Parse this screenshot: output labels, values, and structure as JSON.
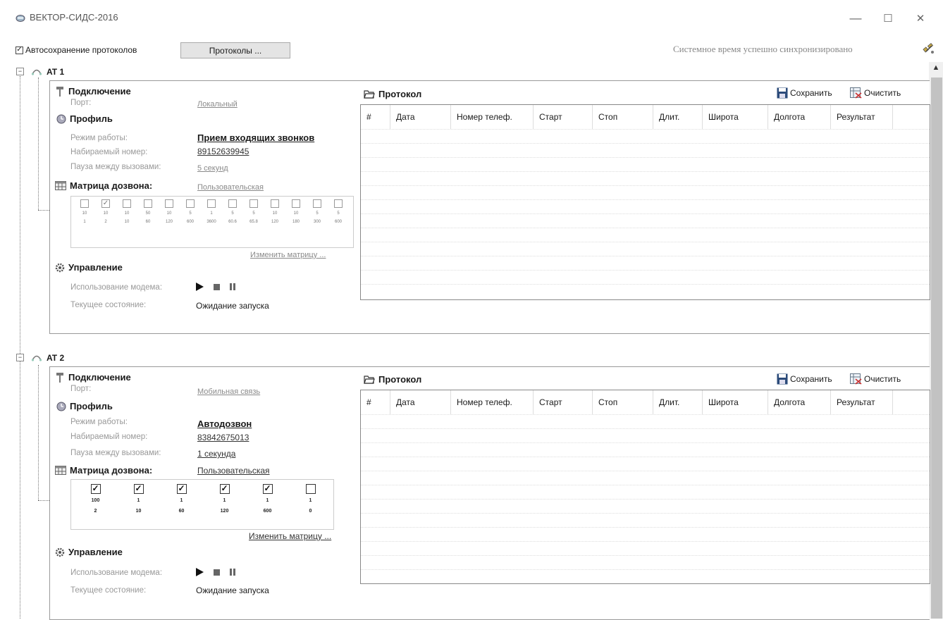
{
  "window": {
    "title": "ВЕКТОР-СИДС-2016",
    "minimize_glyph": "—",
    "maximize_glyph": "☐",
    "close_glyph": "✕"
  },
  "toolbar": {
    "autosave_label": "Автосохранение протоколов",
    "autosave_checked": true,
    "protocols_button": "Протоколы ...",
    "sync_status": "Системное время успешно синхронизировано"
  },
  "common": {
    "connection_title": "Подключение",
    "port_label": "Порт:",
    "profile_title": "Профиль",
    "mode_label": "Режим работы:",
    "dial_number_label": "Набираемый номер:",
    "pause_label": "Пауза между вызовами:",
    "matrix_title": "Матрица дозвона:",
    "change_matrix_link": "Изменить матрицу ...",
    "control_title": "Управление",
    "modem_usage_label": "Использование модема:",
    "current_state_label": "Текущее состояние:",
    "protocol_title": "Протокол",
    "save_button": "Сохранить",
    "clear_button": "Очистить",
    "columns": [
      "#",
      "Дата",
      "Номер телеф.",
      "Старт",
      "Стоп",
      "Длит.",
      "Широта",
      "Долгота",
      "Результат"
    ]
  },
  "nodes": [
    {
      "label": "AT 1",
      "port_value": "Локальный",
      "mode_value": "Прием входящих звонков",
      "dial_number": "89152639945",
      "pause_value": "5 секунд",
      "matrix_value": "Пользовательская",
      "state_value": "Ожидание запуска",
      "matrix_cells": [
        {
          "checked": false,
          "a": "10",
          "b": "1"
        },
        {
          "checked": true,
          "a": "10",
          "b": "2"
        },
        {
          "checked": false,
          "a": "10",
          "b": "10"
        },
        {
          "checked": false,
          "a": "50",
          "b": "60"
        },
        {
          "checked": false,
          "a": "10",
          "b": "120"
        },
        {
          "checked": false,
          "a": "5",
          "b": "600"
        },
        {
          "checked": false,
          "a": "1",
          "b": "3600"
        },
        {
          "checked": false,
          "a": "5",
          "b": "60.6"
        },
        {
          "checked": false,
          "a": "5",
          "b": "65.8"
        },
        {
          "checked": false,
          "a": "10",
          "b": "120"
        },
        {
          "checked": false,
          "a": "10",
          "b": "180"
        },
        {
          "checked": false,
          "a": "5",
          "b": "300"
        },
        {
          "checked": false,
          "a": "5",
          "b": "600"
        }
      ]
    },
    {
      "label": "AT 2",
      "port_value": "Мобильная связь",
      "mode_value": "Автодозвон",
      "dial_number": "83842675013",
      "pause_value": "1 секунда",
      "matrix_value": "Пользовательская",
      "state_value": "Ожидание запуска",
      "matrix_cells": [
        {
          "checked": true,
          "a": "100",
          "b": "2"
        },
        {
          "checked": true,
          "a": "1",
          "b": "10"
        },
        {
          "checked": true,
          "a": "1",
          "b": "60"
        },
        {
          "checked": true,
          "a": "1",
          "b": "120"
        },
        {
          "checked": true,
          "a": "1",
          "b": "600"
        },
        {
          "checked": false,
          "a": "1",
          "b": "0"
        }
      ]
    }
  ]
}
